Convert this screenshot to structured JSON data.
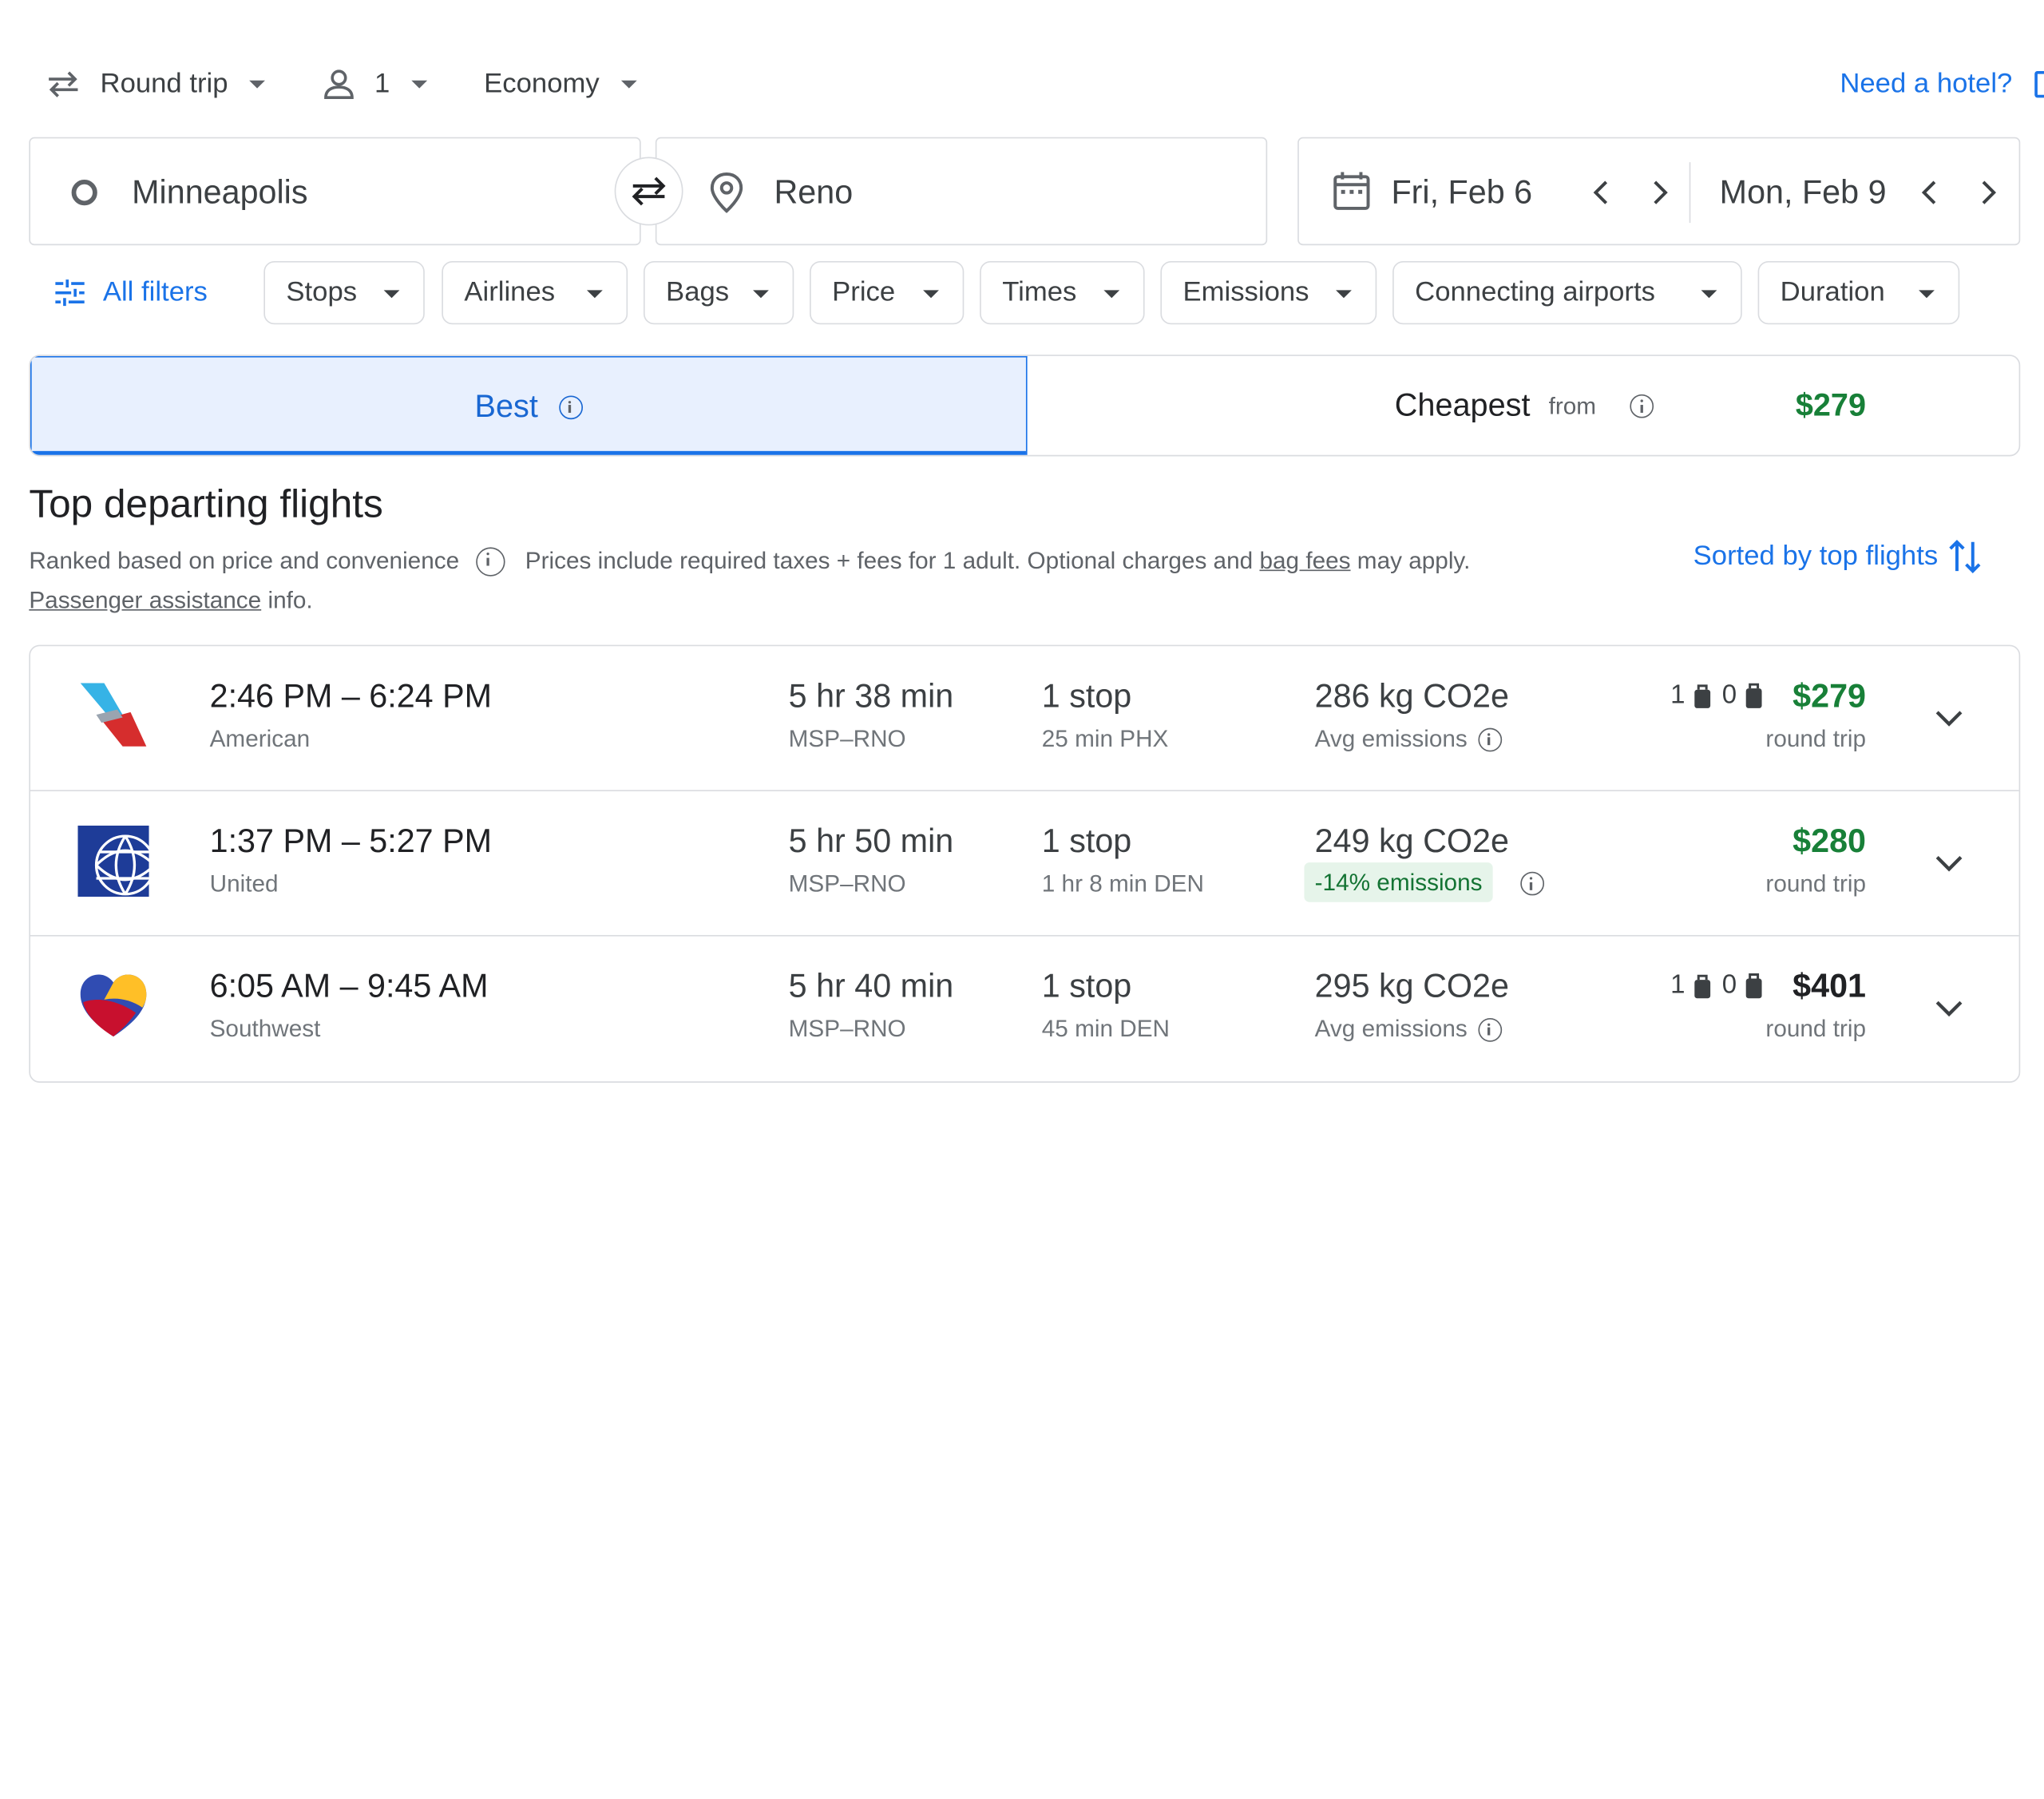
{
  "trip_options": {
    "trip_type": "Round trip",
    "passengers": "1",
    "cabin": "Economy",
    "hotel_link": "Need a hotel?"
  },
  "search": {
    "origin": "Minneapolis",
    "destination": "Reno",
    "depart_date": "Fri, Feb 6",
    "return_date": "Mon, Feb 9"
  },
  "filters": {
    "all_filters": "All filters",
    "chips": [
      "Stops",
      "Airlines",
      "Bags",
      "Price",
      "Times",
      "Emissions",
      "Connecting airports",
      "Duration"
    ]
  },
  "tabs": {
    "best": "Best",
    "cheapest": "Cheapest",
    "cheapest_from": "from",
    "cheapest_price": "$279"
  },
  "results": {
    "heading": "Top departing flights",
    "ranked_text": "Ranked based on price and convenience",
    "prices_text_1": "Prices include required taxes + fees for 1 adult. Optional charges and",
    "bag_fees": "bag fees",
    "prices_text_2": "may apply.",
    "passenger_assistance": "Passenger assistance",
    "info_text": "info.",
    "sorted_by": "Sorted by top flights"
  },
  "flights": [
    {
      "times": "2:46 PM – 6:24 PM",
      "airline": "American",
      "duration": "5 hr 38 min",
      "route": "MSP–RNO",
      "stops": "1 stop",
      "stop_info": "25 min PHX",
      "co2": "286 kg CO2e",
      "emissions": "Avg emissions",
      "carry_on": "1",
      "checked": "0",
      "price": "$279",
      "trip": "round trip"
    },
    {
      "times": "1:37 PM – 5:27 PM",
      "airline": "United",
      "duration": "5 hr 50 min",
      "route": "MSP–RNO",
      "stops": "1 stop",
      "stop_info": "1 hr 8 min DEN",
      "co2": "249 kg CO2e",
      "emissions": "-14% emissions",
      "price": "$280",
      "trip": "round trip"
    },
    {
      "times": "6:05 AM – 9:45 AM",
      "airline": "Southwest",
      "duration": "5 hr 40 min",
      "route": "MSP–RNO",
      "stops": "1 stop",
      "stop_info": "45 min DEN",
      "co2": "295 kg CO2e",
      "emissions": "Avg emissions",
      "carry_on": "1",
      "checked": "0",
      "price": "$401",
      "trip": "round trip"
    }
  ],
  "colors": {
    "accent": "#1a73e8",
    "price_green": "#188038",
    "border": "#dadce0",
    "tab_selected_bg": "#e8f0fe"
  }
}
